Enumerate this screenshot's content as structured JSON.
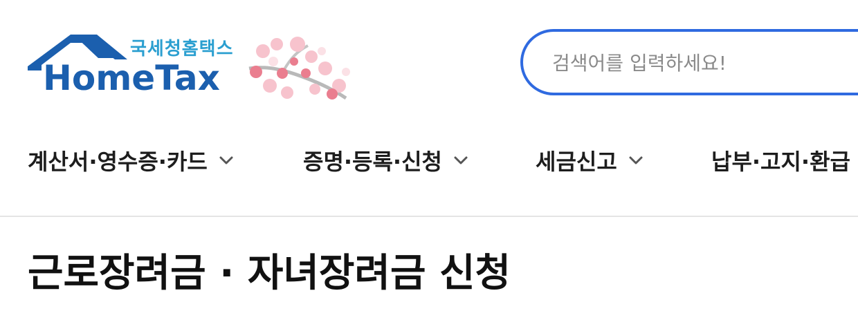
{
  "logo": {
    "korean_name": "국세청홈택스",
    "brand_name": "HomeTax",
    "icons": [
      "house-roof-icon",
      "cherry-blossom-icon"
    ]
  },
  "search": {
    "placeholder": "검색어를 입력하세요!",
    "value": ""
  },
  "nav": {
    "items": [
      {
        "label": "계산서·영수증·카드",
        "icon": "chevron-down-icon"
      },
      {
        "label": "증명·등록·신청",
        "icon": "chevron-down-icon"
      },
      {
        "label": "세금신고",
        "icon": "chevron-down-icon"
      },
      {
        "label": "납부·고지·환급",
        "icon": "chevron-down-icon"
      }
    ]
  },
  "page": {
    "title": "근로장려금 · 자녀장려금 신청"
  },
  "colors": {
    "brand_blue": "#1b5fae",
    "brand_cyan": "#2b9fd0",
    "search_border": "#2f6ae0",
    "blossom_pink": "#f4a9b8"
  }
}
